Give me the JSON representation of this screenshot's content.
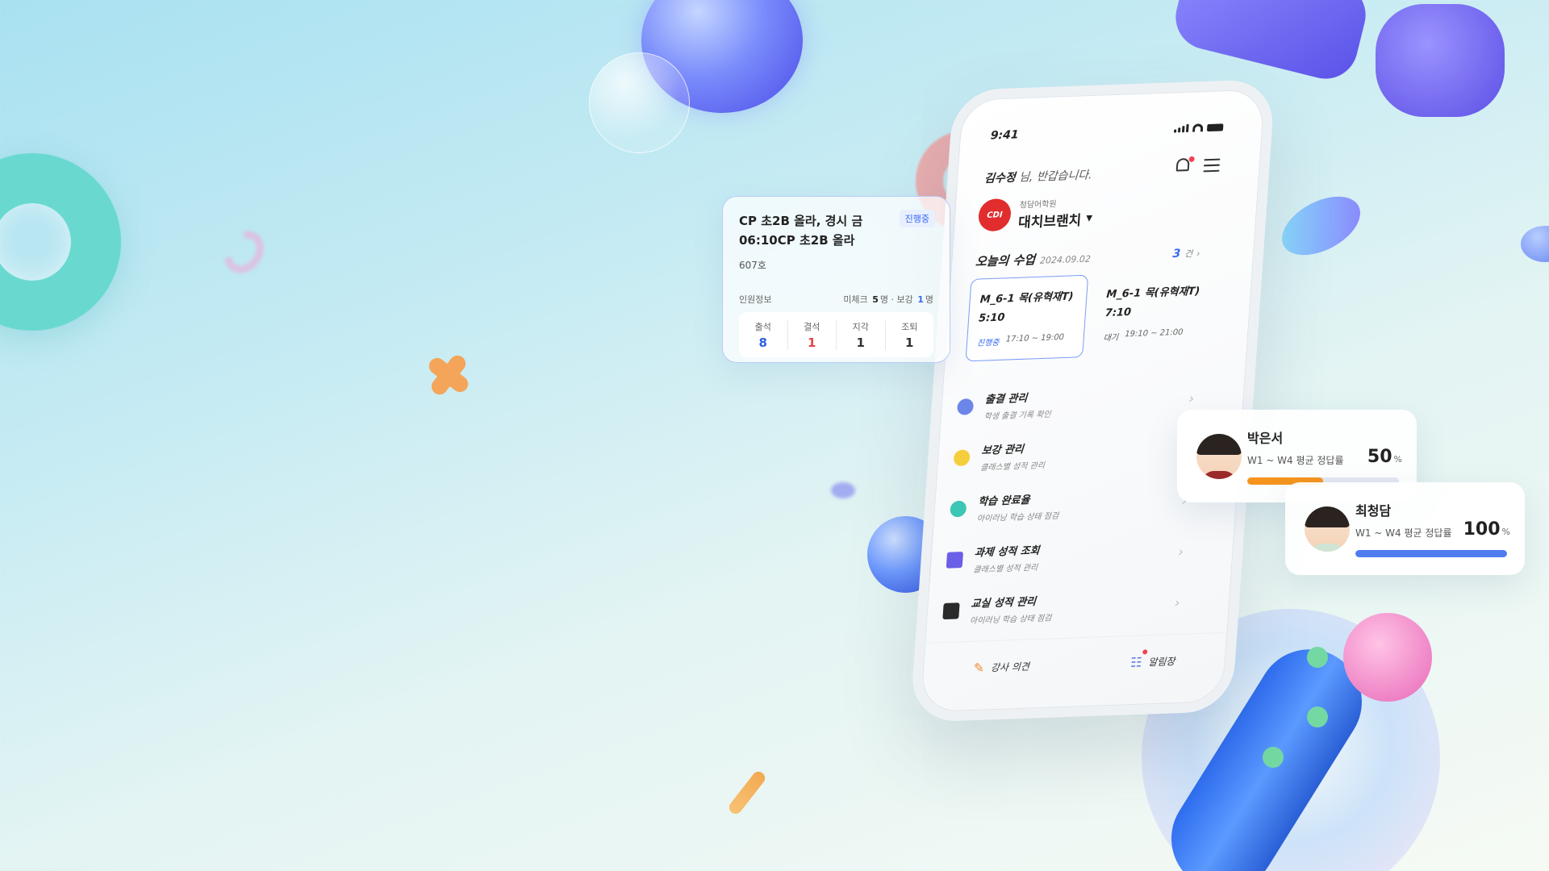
{
  "phone": {
    "time": "9:41",
    "greeting_name": "김수정",
    "greeting_suffix": " 님, 반갑습니다.",
    "logo_text": "CDI",
    "academy_sub": "청담어학원",
    "academy_name": "대치브랜치",
    "today_label": "오늘의 수업",
    "today_date": "2024.09.02",
    "today_count": "3",
    "today_count_unit": "건",
    "classes": [
      {
        "name": "M_6-1 목(유혁재T)",
        "start": "5:10",
        "status": "진행중",
        "range": "17:10 ~ 19:00"
      },
      {
        "name": "M_6-1 목(유혁재T)",
        "start": "7:10",
        "status": "대기",
        "range": "19:10 ~ 21:00"
      }
    ],
    "menu": [
      {
        "title": "출결 관리",
        "subtitle": "학생 출결 기록 확인",
        "icon": "attendance-icon",
        "color": "#6b86e8"
      },
      {
        "title": "보강 관리",
        "subtitle": "클래스별 성적 관리",
        "icon": "bulb-icon",
        "color": "#f5cf3b"
      },
      {
        "title": "학습 완료율",
        "subtitle": "아이러닝 학습 상태 점검",
        "icon": "pie-icon",
        "color": "#3cc6b5"
      },
      {
        "title": "과제 성적 조회",
        "subtitle": "클래스별 성적 관리",
        "icon": "book-icon",
        "color": "#6b5fe8"
      },
      {
        "title": "교실 성적 관리",
        "subtitle": "아이러닝 학습 상태 점검",
        "icon": "graduation-cap-icon",
        "color": "#2a2a2a"
      }
    ],
    "bottom": {
      "opinion": "강사 의견",
      "notice": "알림장"
    }
  },
  "class_card": {
    "title": "CP 초2B 올라, 경시 금 06:10CP 초2B 올라",
    "badge": "진행중",
    "room": "607호",
    "people_label": "인원정보",
    "uncheck_label": "미체크",
    "uncheck_value": "5",
    "makeup_label": "보강",
    "makeup_value": "1",
    "person_unit": "명",
    "stats": [
      {
        "label": "출석",
        "value": "8",
        "color": "#2f5fe0"
      },
      {
        "label": "결석",
        "value": "1",
        "color": "#e04545"
      },
      {
        "label": "지각",
        "value": "1",
        "color": "#333333"
      },
      {
        "label": "조퇴",
        "value": "1",
        "color": "#333333"
      }
    ]
  },
  "students": [
    {
      "name": "박은서",
      "desc": "W1 ~ W4 평균 정답률",
      "percent": "50",
      "unit": "%",
      "progress": 0.5
    },
    {
      "name": "최청담",
      "desc": "W1 ~ W4 평균 정답률",
      "percent": "100",
      "unit": "%",
      "progress": 1.0
    }
  ]
}
